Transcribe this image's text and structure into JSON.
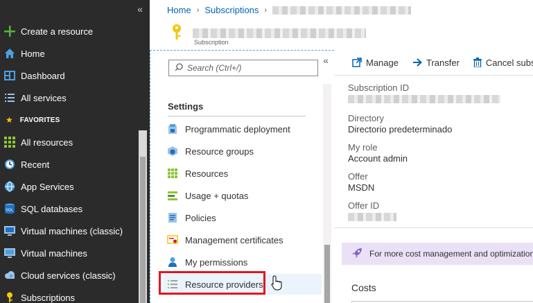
{
  "leftnav": {
    "items": [
      {
        "label": "Create a resource",
        "icon": "plus-icon"
      },
      {
        "label": "Home",
        "icon": "home-icon"
      },
      {
        "label": "Dashboard",
        "icon": "dashboard-icon"
      },
      {
        "label": "All services",
        "icon": "list-icon"
      }
    ],
    "favorites_label": "FAVORITES",
    "favorites": [
      {
        "label": "All resources",
        "icon": "grid-icon"
      },
      {
        "label": "Recent",
        "icon": "clock-icon"
      },
      {
        "label": "App Services",
        "icon": "globe-icon"
      },
      {
        "label": "SQL databases",
        "icon": "sql-icon"
      },
      {
        "label": "Virtual machines (classic)",
        "icon": "monitor-icon"
      },
      {
        "label": "Virtual machines",
        "icon": "monitor-icon"
      },
      {
        "label": "Cloud services (classic)",
        "icon": "cloud-icon"
      },
      {
        "label": "Subscriptions",
        "icon": "key-icon"
      }
    ]
  },
  "header": {
    "breadcrumb": [
      "Home",
      "Subscriptions"
    ],
    "subtitle": "Subscription"
  },
  "settings": {
    "search_placeholder": "Search (Ctrl+/)",
    "title": "Settings",
    "items": [
      {
        "label": "Programmatic deployment",
        "icon": "deployment-icon"
      },
      {
        "label": "Resource groups",
        "icon": "resource-group-icon"
      },
      {
        "label": "Resources",
        "icon": "grid-icon"
      },
      {
        "label": "Usage + quotas",
        "icon": "usage-icon"
      },
      {
        "label": "Policies",
        "icon": "policy-icon"
      },
      {
        "label": "Management certificates",
        "icon": "certificate-icon"
      },
      {
        "label": "My permissions",
        "icon": "person-icon"
      },
      {
        "label": "Resource providers",
        "icon": "list-check-icon"
      }
    ]
  },
  "overview": {
    "toolbar": [
      {
        "label": "Manage",
        "icon": "external-link-icon"
      },
      {
        "label": "Transfer",
        "icon": "arrow-right-icon"
      },
      {
        "label": "Cancel subs",
        "icon": "trash-icon"
      }
    ],
    "properties": [
      {
        "label": "Subscription ID",
        "value": ""
      },
      {
        "label": "Directory",
        "value": "Directorio predeterminado"
      },
      {
        "label": "My role",
        "value": "Account admin"
      },
      {
        "label": "Offer",
        "value": "MSDN"
      },
      {
        "label": "Offer ID",
        "value": ""
      }
    ],
    "banner": "For more cost management and optimization",
    "costs_label": "Costs"
  },
  "colors": {
    "nav_bg": "#2b2b2b",
    "link": "#0063b1",
    "highlight_box": "#e81123",
    "banner_bg": "#ebe1f6"
  }
}
